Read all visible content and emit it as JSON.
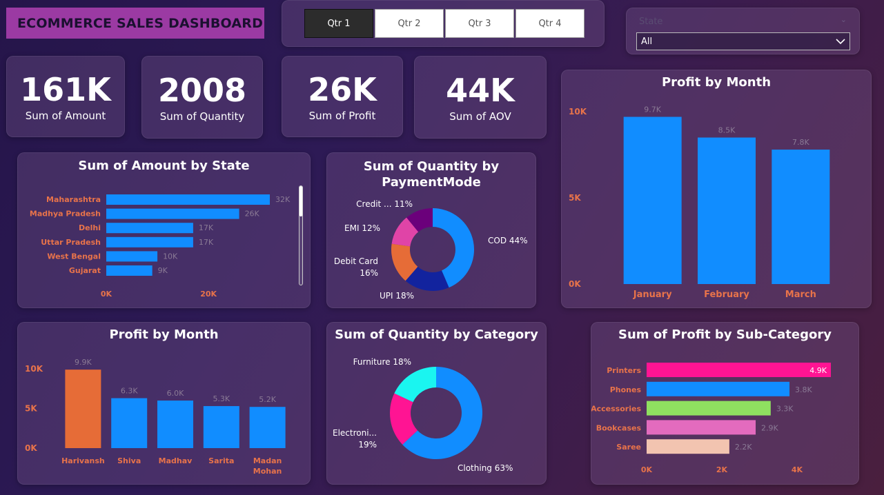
{
  "header": {
    "title": "ECOMMERCE SALES DASHBOARD",
    "quarters": [
      {
        "label": "Qtr 1",
        "active": true
      },
      {
        "label": "Qtr 2",
        "active": false
      },
      {
        "label": "Qtr 3",
        "active": false
      },
      {
        "label": "Qtr 4",
        "active": false
      }
    ],
    "state_filter": {
      "label": "State",
      "value": "All"
    }
  },
  "kpis": [
    {
      "value": "161K",
      "label": "Sum of Amount"
    },
    {
      "value": "2008",
      "label": "Sum of Quantity"
    },
    {
      "value": "26K",
      "label": "Sum of Profit"
    },
    {
      "value": "44K",
      "label": "Sum of AOV"
    }
  ],
  "colors": {
    "blue": "#118dff",
    "orange": "#e66c37",
    "label_orange": "#e8734a",
    "muted": "#8a7a95"
  },
  "chart_data": [
    {
      "id": "amount_by_state",
      "type": "bar",
      "orientation": "horizontal",
      "title": "Sum of Amount by State",
      "categories": [
        "Maharashtra",
        "Madhya Pradesh",
        "Delhi",
        "Uttar Pradesh",
        "West Bengal",
        "Gujarat"
      ],
      "values": [
        32000,
        26000,
        17000,
        17000,
        10000,
        9000
      ],
      "data_labels": [
        "32K",
        "26K",
        "17K",
        "17K",
        "10K",
        "9K"
      ],
      "x_ticks": [
        "0K",
        "20K"
      ],
      "xlim": [
        0,
        32000
      ]
    },
    {
      "id": "qty_by_paymentmode",
      "type": "pie",
      "donut": true,
      "title": "Sum of Quantity by PaymentMode",
      "slices": [
        {
          "label": "COD 44%",
          "value": 44,
          "color": "#118dff"
        },
        {
          "label": "UPI 18%",
          "value": 18,
          "color": "#12239e"
        },
        {
          "label": "Debit Card 16%",
          "value": 16,
          "color": "#e66c37"
        },
        {
          "label": "EMI 12%",
          "value": 12,
          "color": "#e044a7"
        },
        {
          "label": "Credit ... 11%",
          "value": 11,
          "color": "#6b007b"
        }
      ]
    },
    {
      "id": "profit_by_month",
      "type": "bar",
      "title": "Profit by Month",
      "categories": [
        "January",
        "February",
        "March"
      ],
      "values": [
        9700,
        8500,
        7800
      ],
      "data_labels": [
        "9.7K",
        "8.5K",
        "7.8K"
      ],
      "y_ticks": [
        "0K",
        "5K",
        "10K"
      ],
      "ylim": [
        0,
        10000
      ]
    },
    {
      "id": "profit_by_customer",
      "type": "bar",
      "title": "Profit by Month",
      "categories": [
        "Harivansh",
        "Shiva",
        "Madhav",
        "Sarita",
        "Madan Mohan"
      ],
      "values": [
        9900,
        6300,
        6000,
        5300,
        5200
      ],
      "data_labels": [
        "9.9K",
        "6.3K",
        "6.0K",
        "5.3K",
        "5.2K"
      ],
      "y_ticks": [
        "0K",
        "5K",
        "10K"
      ],
      "ylim": [
        0,
        10000
      ],
      "highlight_color": "#e66c37"
    },
    {
      "id": "qty_by_category",
      "type": "pie",
      "donut": true,
      "title": "Sum of Quantity by Category",
      "slices": [
        {
          "label": "Clothing 63%",
          "value": 63,
          "color": "#118dff"
        },
        {
          "label": "Electroni... 19%",
          "value": 19,
          "color": "#ff1493"
        },
        {
          "label": "Furniture 18%",
          "value": 18,
          "color": "#1af5f0"
        }
      ]
    },
    {
      "id": "profit_by_subcategory",
      "type": "bar",
      "orientation": "horizontal",
      "title": "Sum of Profit by Sub-Category",
      "categories": [
        "Printers",
        "Phones",
        "Accessories",
        "Bookcases",
        "Saree"
      ],
      "values": [
        4900,
        3800,
        3300,
        2900,
        2200
      ],
      "data_labels": [
        "4.9K",
        "3.8K",
        "3.3K",
        "2.9K",
        "2.2K"
      ],
      "colors": [
        "#ff1493",
        "#118dff",
        "#8fe060",
        "#e36bbe",
        "#f2c4b0"
      ],
      "x_ticks": [
        "0K",
        "2K",
        "4K"
      ],
      "xlim": [
        0,
        4900
      ]
    }
  ]
}
